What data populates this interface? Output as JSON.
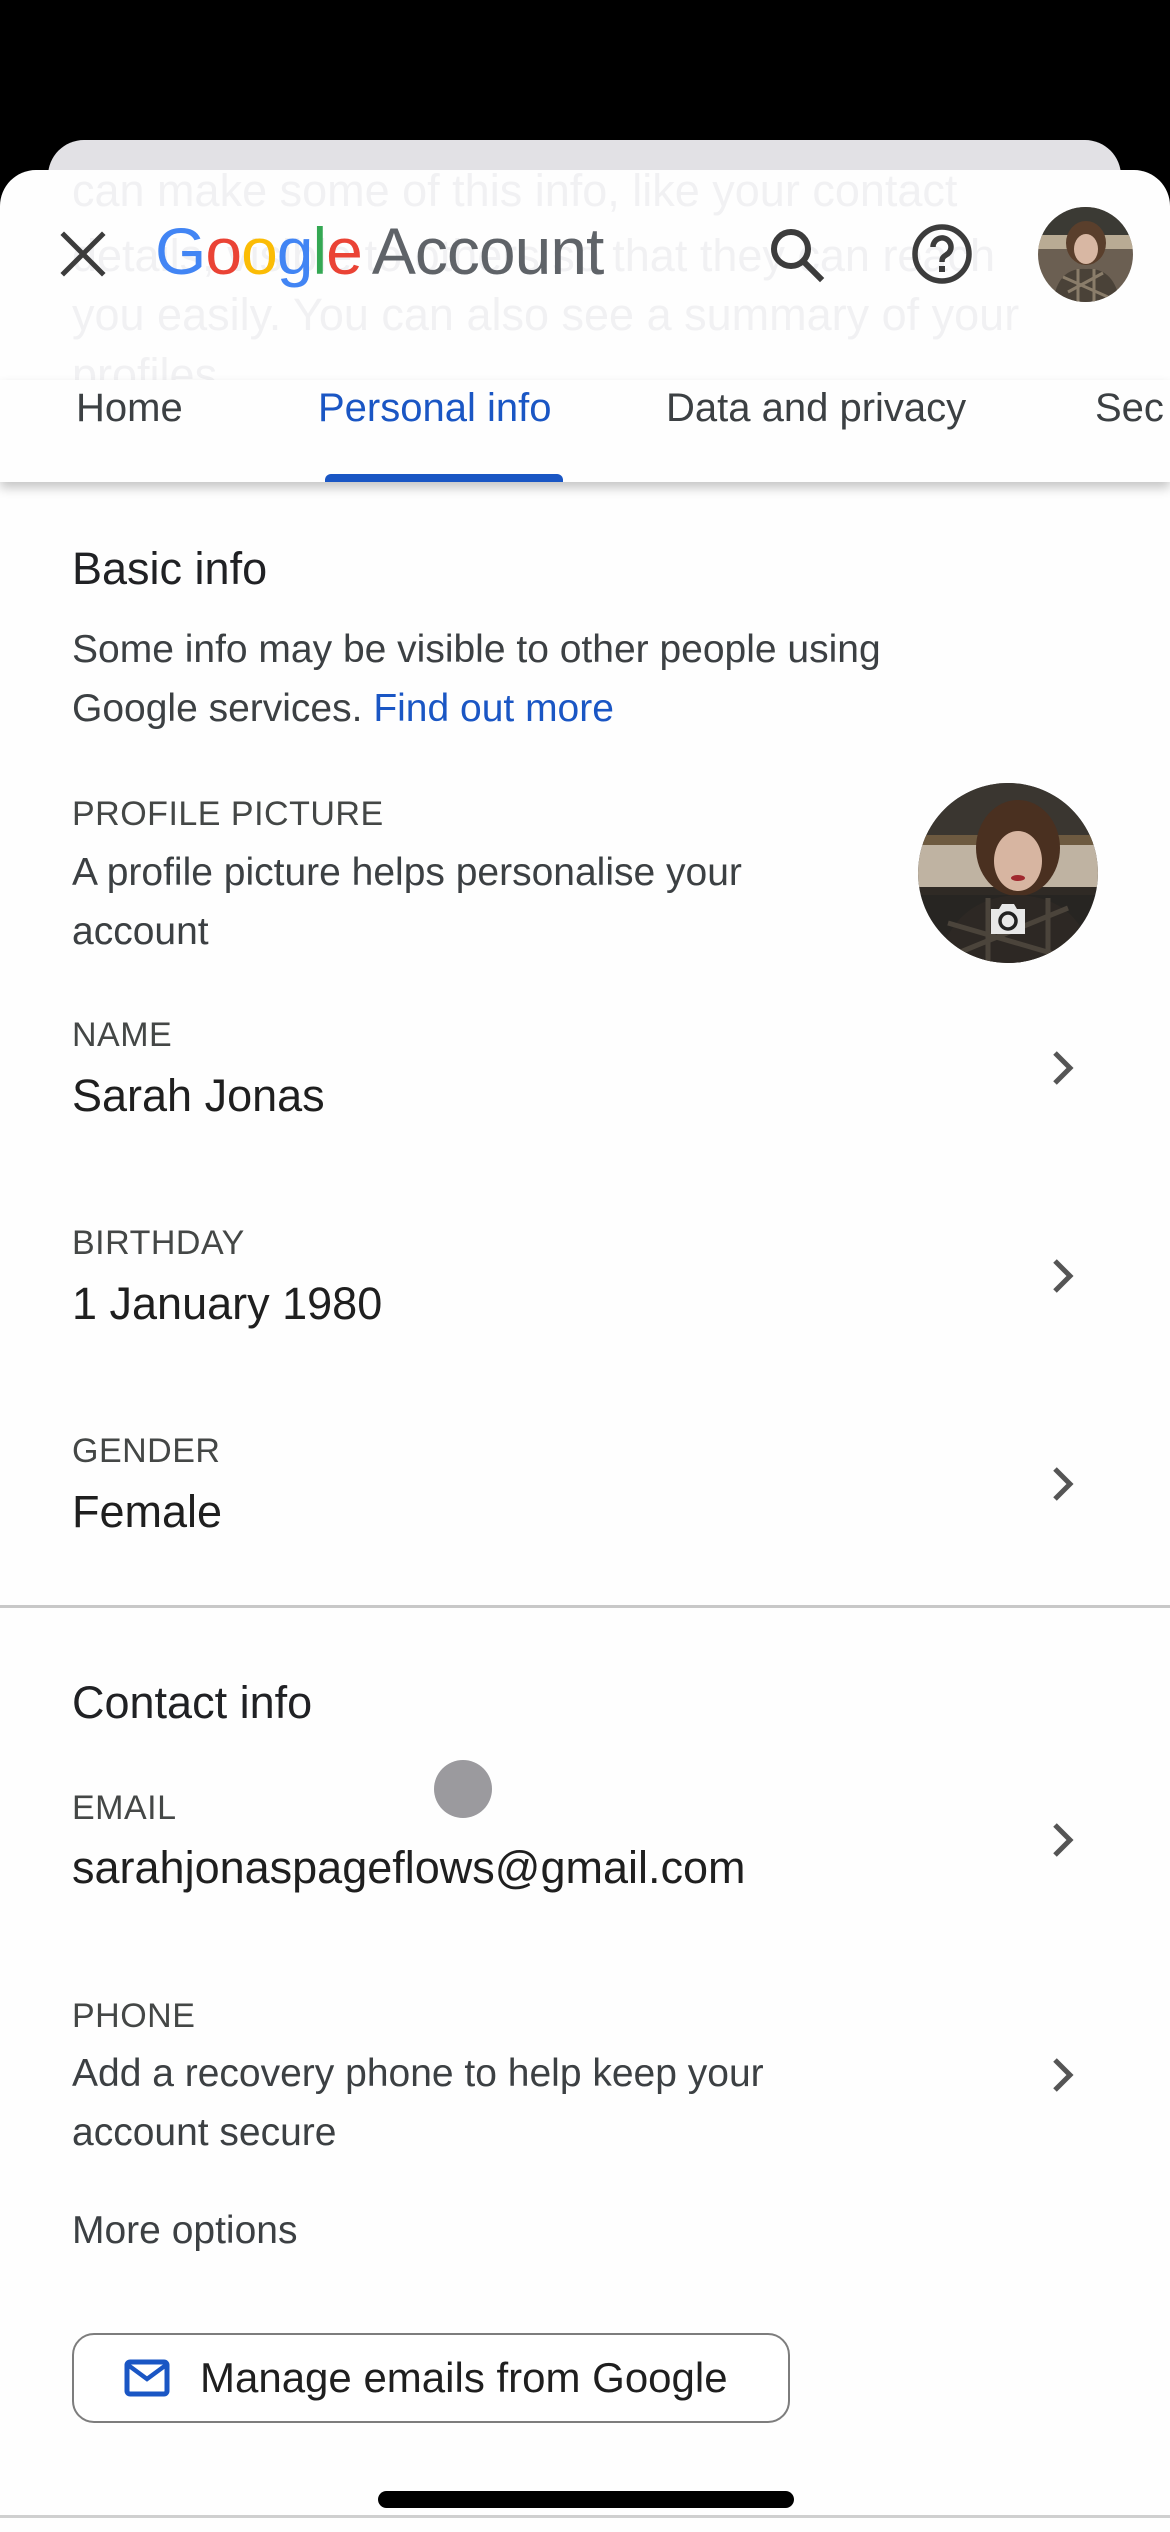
{
  "header": {
    "close_icon": "close-icon",
    "logo_letters": [
      "G",
      "o",
      "o",
      "g",
      "l",
      "e"
    ],
    "logo_suffix": "Account",
    "search_icon": "search-icon",
    "help_icon": "help-icon",
    "avatar_alt": "Sarah Jonas profile photo"
  },
  "background_text": [
    "can make some of this info, like your contact",
    "details, visible to others so that they can reach",
    "you easily. You can also see a summary of your",
    "profiles."
  ],
  "tabs": [
    {
      "label": "Home",
      "active": false
    },
    {
      "label": "Personal info",
      "active": true
    },
    {
      "label": "Data and privacy",
      "active": false
    },
    {
      "label": "Sec",
      "active": false
    }
  ],
  "basic_info": {
    "title": "Basic info",
    "description_line1": "Some info may be visible to other people using",
    "description_line2": "Google services.",
    "find_out_more": "Find out more",
    "profile_picture": {
      "label": "PROFILE PICTURE",
      "description_line1": "A profile picture helps personalise your",
      "description_line2": "account",
      "camera_icon": "camera-icon"
    },
    "name": {
      "label": "NAME",
      "value": "Sarah Jonas"
    },
    "birthday": {
      "label": "BIRTHDAY",
      "value": "1 January 1980"
    },
    "gender": {
      "label": "GENDER",
      "value": "Female"
    }
  },
  "contact_info": {
    "title": "Contact info",
    "email": {
      "label": "EMAIL",
      "value": "sarahjonaspageflows@gmail.com"
    },
    "phone": {
      "label": "PHONE",
      "description_line1": "Add a recovery phone to help keep your",
      "description_line2": "account secure"
    },
    "more_options": "More options",
    "manage_emails_button": "Manage emails from Google"
  },
  "colors": {
    "accent_blue": "#1a56c4",
    "text_primary": "#1f1f1f",
    "text_secondary": "#444746",
    "google_blue": "#4285f4",
    "google_red": "#ea4335",
    "google_yellow": "#fbbc05",
    "google_green": "#34a853"
  }
}
